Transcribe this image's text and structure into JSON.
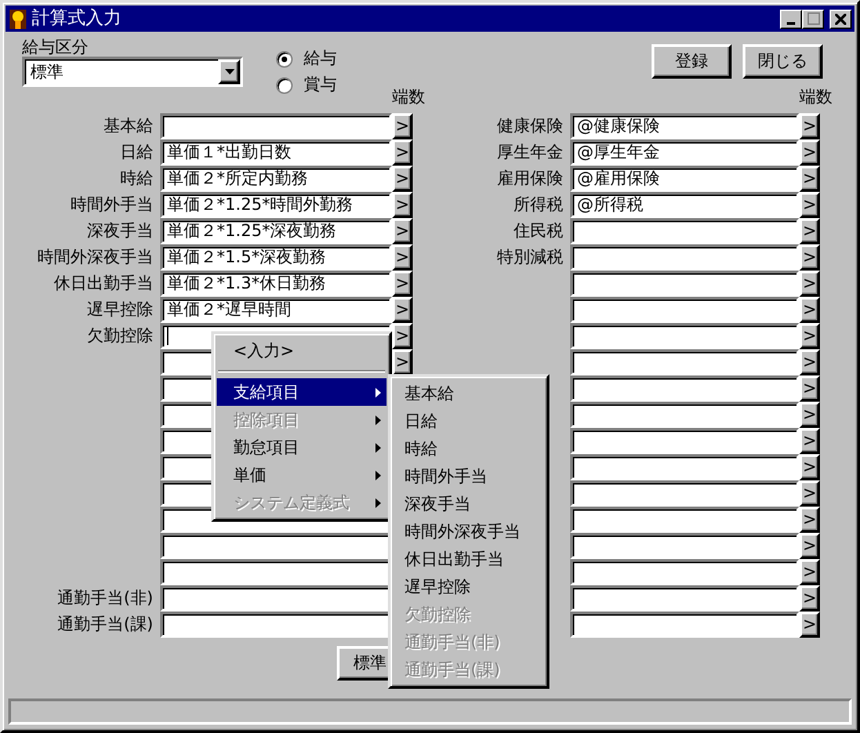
{
  "window": {
    "title": "計算式入力"
  },
  "salary_type": {
    "label": "給与区分",
    "value": "標準"
  },
  "pay_kind": [
    {
      "label": "給与",
      "selected": true
    },
    {
      "label": "賞与",
      "selected": false
    }
  ],
  "buttons": [
    "登録",
    "閉じる"
  ],
  "left": {
    "header": "端数",
    "rows": [
      {
        "label": "基本給",
        "value": "",
        "button": ">"
      },
      {
        "label": "日給",
        "value": "単価１*出勤日数",
        "button": ">"
      },
      {
        "label": "時給",
        "value": "単価２*所定内勤務",
        "button": ">"
      },
      {
        "label": "時間外手当",
        "value": "単価２*1.25*時間外勤務",
        "button": ">"
      },
      {
        "label": "深夜手当",
        "value": "単価２*1.25*深夜勤務",
        "button": ">"
      },
      {
        "label": "時間外深夜手当",
        "value": "単価２*1.5*深夜勤務",
        "button": ">"
      },
      {
        "label": "休日出勤手当",
        "value": "単価２*1.3*休日勤務",
        "button": ">"
      },
      {
        "label": "遅早控除",
        "value": "単価２*遅早時間",
        "button": ">"
      },
      {
        "label": "欠勤控除",
        "value": "",
        "button": ">",
        "focused": true
      },
      {
        "value": "",
        "button": ">"
      },
      {
        "value": ""
      },
      {
        "value": ""
      },
      {
        "value": ""
      },
      {
        "value": ""
      },
      {
        "value": ""
      },
      {
        "value": ""
      },
      {
        "value": ""
      },
      {
        "value": ""
      },
      {
        "label": "通勤手当(非)",
        "value": ""
      },
      {
        "label": "通勤手当(課)",
        "value": ""
      }
    ]
  },
  "right": {
    "header": "端数",
    "rows": [
      {
        "label": "健康保険",
        "value": "@健康保険",
        "button": ">"
      },
      {
        "label": "厚生年金",
        "value": "@厚生年金",
        "button": ">"
      },
      {
        "label": "雇用保険",
        "value": "@雇用保険",
        "button": ">"
      },
      {
        "label": "所得税",
        "value": "@所得税",
        "button": ">"
      },
      {
        "label": "住民税",
        "value": "",
        "button": ">"
      },
      {
        "label": "特別減税",
        "value": "",
        "button": ">"
      },
      {
        "value": "",
        "button": ">"
      },
      {
        "value": "",
        "button": ">"
      },
      {
        "value": "",
        "button": ">"
      },
      {
        "value": "",
        "button": ">"
      },
      {
        "value": "",
        "button": ">"
      },
      {
        "value": "",
        "button": ">"
      },
      {
        "value": "",
        "button": ">"
      },
      {
        "value": "",
        "button": ">"
      },
      {
        "value": "",
        "button": ">"
      },
      {
        "value": "",
        "button": ">"
      },
      {
        "value": "",
        "button": ">"
      },
      {
        "value": "",
        "button": ">"
      },
      {
        "value": "",
        "button": ">"
      },
      {
        "value": "",
        "button": ">"
      }
    ]
  },
  "bottom_button": "標準",
  "menu": {
    "items": [
      {
        "kind": "command",
        "label": "<入力>",
        "disabled": false,
        "selected": false
      },
      {
        "kind": "separator"
      },
      {
        "kind": "submenu",
        "label": "支給項目",
        "disabled": false,
        "selected": true
      },
      {
        "kind": "submenu",
        "label": "控除項目",
        "disabled": true,
        "selected": false
      },
      {
        "kind": "submenu",
        "label": "勤怠項目",
        "disabled": false,
        "selected": false
      },
      {
        "kind": "submenu",
        "label": "単価",
        "disabled": false,
        "selected": false
      },
      {
        "kind": "submenu",
        "label": "システム定義式",
        "disabled": true,
        "selected": false
      }
    ]
  },
  "submenu": {
    "items": [
      {
        "label": "基本給",
        "disabled": false
      },
      {
        "label": "日給",
        "disabled": false
      },
      {
        "label": "時給",
        "disabled": false
      },
      {
        "label": "時間外手当",
        "disabled": false
      },
      {
        "label": "深夜手当",
        "disabled": false
      },
      {
        "label": "時間外深夜手当",
        "disabled": false
      },
      {
        "label": "休日出勤手当",
        "disabled": false
      },
      {
        "label": "遅早控除",
        "disabled": false
      },
      {
        "label": "欠勤控除",
        "disabled": true
      },
      {
        "label": "通勤手当(非)",
        "disabled": true
      },
      {
        "label": "通勤手当(課)",
        "disabled": true
      }
    ]
  }
}
